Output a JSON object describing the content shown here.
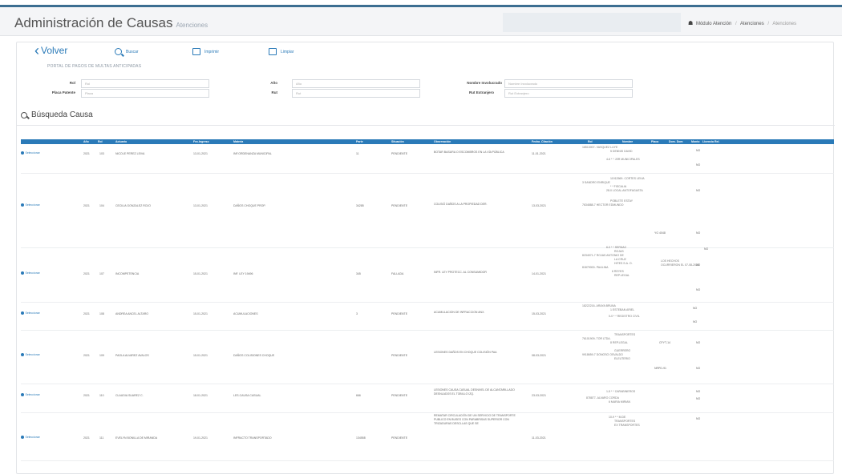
{
  "header": {
    "title": "Administración de Causas",
    "subtitle": "Atenciones",
    "breadcrumb": [
      "Módulo Atención",
      "Atenciones",
      "Atenciones"
    ]
  },
  "toolbar": {
    "volver": "Volver",
    "buscar": "Buscar",
    "imprimir": "Imprimir",
    "limpiar": "Limpiar"
  },
  "portal_title": "PORTAL DE PAGOS DE MULTAS ANTICIPADAS",
  "form": {
    "rol_label": "Rol",
    "rol_placeholder": "Rol",
    "placa_label": "Placa Patente",
    "placa_placeholder": "Placa",
    "anio_label": "Año",
    "anio_placeholder": "Año",
    "rut_label": "Rut",
    "rut_placeholder": "Rut",
    "nombre_label": "Nombre Involucrado",
    "nombre_placeholder": "Nombre Involucrado",
    "rut_ext_label": "Rut Extranjero",
    "rut_ext_placeholder": "Rut Extranjero"
  },
  "section_title": "Búsqueda Causa",
  "table": {
    "headers": [
      "Año",
      "Rol",
      "Actuario",
      "Fec.Ingreso",
      "Materia",
      "Parte",
      "Situación",
      "Observación",
      "Fecha_Citación",
      "Rol",
      "Nombre",
      "Placa",
      "Dom. Dom",
      "Monto",
      "Licencia Rel."
    ],
    "select_label": "Seleccionar",
    "rows": [
      {
        "anio": "2021",
        "rol": "103",
        "actuario": "NICOLE PEREZ LEIVA",
        "fec": "13-01-2021",
        "materia": "INF.ORDENANZA MUNICIPAL",
        "parte": "11",
        "situacion": "PENDIENTE",
        "obs": "BOTAR BASURA O ESCOMBROS EN LA VÍA PÚBLICA",
        "fcita": "11-01-2021",
        "rel": [
          "16513007- VASQUEZ LUYE",
          "5 DENNIS DAVID",
          "4-6 * * JSR MUNICIPALES"
        ],
        "montos": [
          "NO",
          "NO"
        ]
      },
      {
        "anio": "2021",
        "rol": "104",
        "actuario": "CECILIA GONZALEZ ROJO",
        "fec": "13-01-2021",
        "materia": "DAÑOS CHOQUE PROP.",
        "parte": "34285",
        "situacion": "PENDIENTE",
        "obs": "COLISIÓ DAÑOS A LA PROPIEDAD DER.",
        "fcita": "13-03-2021",
        "rel": [
          "11912569- CORTES LEIVA",
          "3 SANDRO ENRIQUE",
          "* * FISCALIA",
          "28-0 LOCAL ANTOFAGASTA",
          "POBLETE ESTAY",
          "7634888-7 HECTOR EDMUNDO"
        ],
        "extra": "YG 4048",
        "montos": [
          "NO",
          "NO"
        ]
      },
      {
        "anio": "2021",
        "rol": "107",
        "actuario": "INCOMPETENCIA",
        "fec": "15-01-2021",
        "materia": "INF. LEY 19496",
        "parte": "345",
        "situacion": "FALLADA",
        "obs": "INFR. LEY PROTECC. AL CONSUMIDOR",
        "fcita": "14-01-2021",
        "rel": [
          "6-0 * * SERNAC",
          "ROJAS",
          "8234971-7 ROJAS ANTONIO DE",
          "LA CRUZ",
          "HITES S.A. O.",
          "81879000- PAULINA",
          "6 REYES",
          "REP.LEGAL"
        ],
        "extra2": [
          "LOS HECHOS",
          "OCURRIERON EL 07-08-2020"
        ],
        "montos": [
          "NO",
          "NO",
          "NO"
        ]
      },
      {
        "anio": "2021",
        "rol": "108",
        "actuario": "ANDREA ANCEL ALTARO",
        "fec": "15-01-2021",
        "materia": "ACUMULACIONES",
        "parte": "3",
        "situacion": "PENDIENTE",
        "obs": "ACUMULACION DE INFRACCION ANX.",
        "fcita": "15-03-2021",
        "rel": [
          "18222216- ARAYA BRUNA",
          "1 ESTEBAN ARIEL",
          "0-0 * * REGISTRO CIVIL"
        ],
        "montos": [
          "NO",
          "NO"
        ]
      },
      {
        "anio": "2021",
        "rol": "109",
        "actuario": "PAOLA ALVAREZ AVALOS",
        "fec": "15-01-2021",
        "materia": "DAÑOS COLISIONES CHOQUE",
        "parte": "",
        "situacion": "PENDIENTE",
        "obs": "LESIONES DAÑOS EN CHOQUE COLISIÓN PAA",
        "fcita": "08-03-2021",
        "rel": [
          "TRANSPORTES",
          "76101909- TOR LTDA.",
          "8 REP.LEGAL",
          "GUERRERO",
          "9918659-7 DONOSO OSVALDO",
          "ELEUTERIO"
        ],
        "extra": "CFYT-14",
        "extra3": "NRPD-91",
        "montos": [
          "NO",
          "NO"
        ]
      },
      {
        "anio": "2021",
        "rol": "110",
        "actuario": "CLAUDIA SUAREZ C.",
        "fec": "18-01-2021",
        "materia": "LES.CAUSA CASUAL",
        "parte": "666",
        "situacion": "PENDIENTE",
        "obs": "LESIONES CAUSA CASUAL DESNIVEL DE ALCANTARILLADO DESNLADOS EL TOBILLO IZQ.",
        "fcita": "23-03-2021",
        "rel": [
          "1-5 * * CARABINEROS",
          "878877- ALVARO CORDA",
          "6 MARIA MIRIAN"
        ],
        "montos": [
          "NO",
          "NO"
        ]
      },
      {
        "anio": "2021",
        "rol": "111",
        "actuario": "EVELYN BONILLA DE MIRANDA",
        "fec": "19-01-2021",
        "materia": "INFRACTO TRANSPORTADO",
        "parte": "134558",
        "situacion": "PENDIENTE",
        "obs": "REMATAR CIRCULACIÓN DE UN SERVICIO DE TRANSPORTE PUBLICO EN BUSES CON PARABRISAS SUPERIOR CON TRIZADURAS DESCLLAS QUE SE",
        "fcita": "11-03-2021",
        "rel": [
          "10-9 * * M.DE",
          "TRANSPORTES",
          "EX TRANSPORTES"
        ],
        "montos": [
          "NO"
        ]
      }
    ]
  }
}
